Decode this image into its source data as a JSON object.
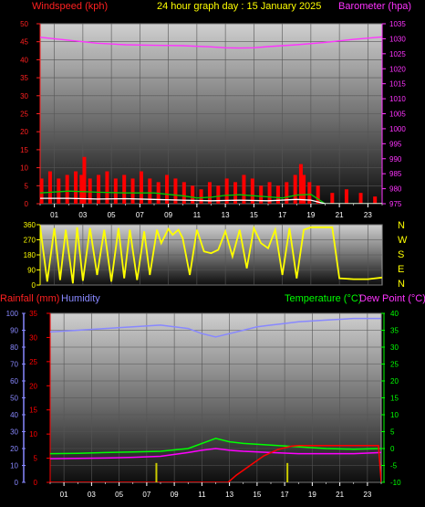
{
  "header": {
    "left_label": "Windspeed (kph)",
    "center_label": "24 hour graph day : 15 January 2025",
    "right_label": "Barometer (hpa)"
  },
  "direction_letters": [
    "N",
    "W",
    "S",
    "E",
    "N"
  ],
  "lower_header": {
    "rainfall_label": "Rainfall (mm)",
    "humidity_label": "Humidity",
    "temperature_label": "Temperature (°C)",
    "dewpoint_label": "Dew Point (°C)"
  },
  "colors": {
    "background": "#000000",
    "windspeed": "#ff0000",
    "barometer": "#ff33ff",
    "wind_direction": "#ffff00",
    "rainfall": "#ff0000",
    "humidity": "#8888ff",
    "temperature": "#00ff00",
    "dew_point": "#ff00ff",
    "gust": "#ff0000",
    "avg_wind": "#00cc00",
    "min_wind": "#ffffff"
  },
  "chart_data": [
    {
      "type": "line",
      "title": "24 hour graph day : 15 January 2025",
      "x_tick_labels": [
        "01",
        "03",
        "05",
        "07",
        "09",
        "11",
        "13",
        "15",
        "17",
        "19",
        "21",
        "23"
      ],
      "xlim": [
        0,
        24
      ],
      "left_axis": {
        "label": "Windspeed (kph)",
        "ylim": [
          0,
          50
        ],
        "ticks": [
          0,
          5,
          10,
          15,
          20,
          25,
          30,
          35,
          40,
          45,
          50
        ]
      },
      "right_axis": {
        "label": "Barometer (hpa)",
        "ylim": [
          975,
          1035
        ],
        "ticks": [
          975,
          980,
          985,
          990,
          995,
          1000,
          1005,
          1010,
          1015,
          1020,
          1025,
          1030,
          1035
        ]
      },
      "series": [
        {
          "name": "Barometer (hpa)",
          "axis": "right",
          "x": [
            0,
            2,
            4,
            6,
            8,
            10,
            12,
            13,
            14,
            15,
            16,
            18,
            20,
            22,
            24
          ],
          "values": [
            1030.5,
            1029.5,
            1028.5,
            1028.0,
            1027.8,
            1027.7,
            1027.3,
            1027.0,
            1026.9,
            1027.0,
            1027.4,
            1028.0,
            1028.8,
            1029.8,
            1030.6
          ]
        },
        {
          "axis": "left",
          "x": [
            0.1,
            0.7,
            1.3,
            1.9,
            2.5,
            2.9,
            3.1,
            3.5,
            4.1,
            4.7,
            5.3,
            5.9,
            6.5,
            7.1,
            7.7,
            8.3,
            8.9,
            9.5,
            10.1,
            10.7,
            11.3,
            11.9,
            12.5,
            13.1,
            13.7,
            14.3,
            14.9,
            15.5,
            16.1,
            16.7,
            17.3,
            17.9,
            18.3,
            18.5,
            18.9,
            19.5,
            20.5,
            21.5,
            22.5,
            23.5
          ],
          "values": [
            7,
            9,
            7,
            8,
            9,
            8,
            13,
            7,
            8,
            9,
            7,
            8,
            7,
            9,
            7,
            6,
            8,
            7,
            6,
            5,
            4,
            6,
            5,
            7,
            6,
            8,
            7,
            5,
            6,
            5,
            6,
            8,
            11,
            8,
            6,
            5,
            3,
            4,
            3,
            2
          ]
        },
        {
          "axis": "left",
          "x": [
            0,
            2,
            4,
            6,
            8,
            9,
            10,
            11,
            12,
            13,
            14,
            15,
            16,
            17,
            18,
            19,
            20,
            24
          ],
          "values": [
            3,
            3.5,
            3.2,
            3,
            3,
            2.6,
            2.2,
            1.6,
            1.8,
            2.3,
            2.5,
            2.2,
            1.9,
            1.6,
            2.4,
            2.6,
            0,
            0
          ]
        },
        {
          "axis": "left",
          "x": [
            0,
            2,
            4,
            6,
            8,
            10,
            12,
            14,
            16,
            18,
            19,
            20,
            24
          ],
          "values": [
            1.5,
            1.5,
            1.3,
            1.4,
            1.2,
            1,
            0.8,
            1,
            0.8,
            1.2,
            1,
            0,
            0
          ]
        }
      ]
    },
    {
      "type": "line",
      "x_tick_labels": [],
      "xlim": [
        0,
        24
      ],
      "y_axis": {
        "ylim": [
          0,
          360
        ],
        "ticks": [
          0,
          90,
          180,
          270,
          360
        ]
      },
      "direction_letters": [
        "N",
        "W",
        "S",
        "E",
        "N"
      ],
      "series": [
        {
          "axis": "left",
          "x": [
            0,
            0.5,
            1,
            1.4,
            1.8,
            2.3,
            2.6,
            3,
            3.5,
            4,
            4.5,
            5,
            5.5,
            5.9,
            6.3,
            6.8,
            7.3,
            7.7,
            8.2,
            8.5,
            9,
            9.3,
            9.7,
            10,
            10.5,
            11,
            11.5,
            12,
            12.5,
            13,
            13.5,
            14,
            14.5,
            15,
            15.5,
            16,
            16.5,
            17,
            17.5,
            18,
            18.5,
            19,
            19.5,
            20,
            20.5,
            21,
            22,
            23,
            24
          ],
          "values": [
            350,
            20,
            340,
            30,
            330,
            10,
            345,
            25,
            340,
            60,
            330,
            20,
            340,
            40,
            330,
            30,
            320,
            60,
            330,
            250,
            335,
            300,
            330,
            280,
            60,
            330,
            200,
            190,
            210,
            320,
            170,
            330,
            100,
            340,
            250,
            220,
            330,
            60,
            340,
            40,
            330,
            345,
            345,
            345,
            345,
            40,
            35,
            35,
            45
          ]
        }
      ]
    },
    {
      "type": "line",
      "x_tick_labels": [
        "01",
        "03",
        "05",
        "07",
        "09",
        "11",
        "13",
        "15",
        "17",
        "19",
        "21",
        "23"
      ],
      "xlim": [
        0,
        24
      ],
      "humidity_axis": {
        "label": "Humidity",
        "ylim": [
          0,
          100
        ],
        "ticks": [
          0,
          10,
          20,
          30,
          40,
          50,
          60,
          70,
          80,
          90,
          100
        ]
      },
      "rain_axis": {
        "label": "Rainfall (mm)",
        "ylim": [
          0,
          35
        ],
        "ticks": [
          0,
          5,
          10,
          15,
          20,
          25,
          30,
          35
        ]
      },
      "temperature_axis": {
        "label": "Temperature (°C)",
        "ylim": [
          -10,
          40
        ],
        "ticks": [
          -10,
          -5,
          0,
          5,
          10,
          15,
          20,
          25,
          30,
          35,
          40
        ]
      },
      "series": [
        {
          "name": "Humidity",
          "axis": "humidity",
          "x": [
            0,
            2,
            4,
            6,
            8,
            10,
            11,
            12,
            13,
            14,
            15,
            16,
            17,
            18,
            20,
            22,
            24
          ],
          "values": [
            89,
            90,
            91,
            92,
            93,
            91,
            88,
            86,
            88,
            90,
            92,
            93,
            94,
            95,
            96,
            97,
            97
          ]
        },
        {
          "name": "Temperature (°C)",
          "axis": "temperature",
          "x": [
            0,
            2,
            4,
            6,
            8,
            10,
            11,
            12,
            13,
            14,
            16,
            18,
            20,
            22,
            24
          ],
          "values": [
            -1.5,
            -1.4,
            -1.2,
            -1,
            -0.8,
            0,
            1.5,
            3,
            2,
            1.5,
            1,
            0.5,
            0,
            -0.2,
            0
          ]
        },
        {
          "name": "Dew Point (°C)",
          "axis": "temperature",
          "x": [
            0,
            2,
            4,
            6,
            8,
            10,
            11,
            12,
            13,
            14,
            16,
            18,
            20,
            22,
            24
          ],
          "values": [
            -3,
            -2.9,
            -2.8,
            -2.6,
            -2.3,
            -1.2,
            -0.5,
            0,
            -0.5,
            -0.8,
            -1.2,
            -1.5,
            -1.5,
            -1.5,
            -1.2
          ]
        },
        {
          "name": "Rainfall (mm)",
          "axis": "rain",
          "x": [
            0,
            12,
            12.9,
            13.5,
            14.5,
            15.5,
            16.5,
            17.5,
            18,
            20,
            22,
            23.8,
            24
          ],
          "values": [
            0,
            0,
            0,
            1.5,
            3.5,
            5.5,
            6.8,
            7.5,
            7.6,
            7.6,
            7.6,
            7.6,
            0
          ]
        },
        {
          "axis": "rain",
          "x": [
            7.7,
            17.2
          ],
          "values": [
            4,
            4
          ]
        }
      ]
    }
  ]
}
